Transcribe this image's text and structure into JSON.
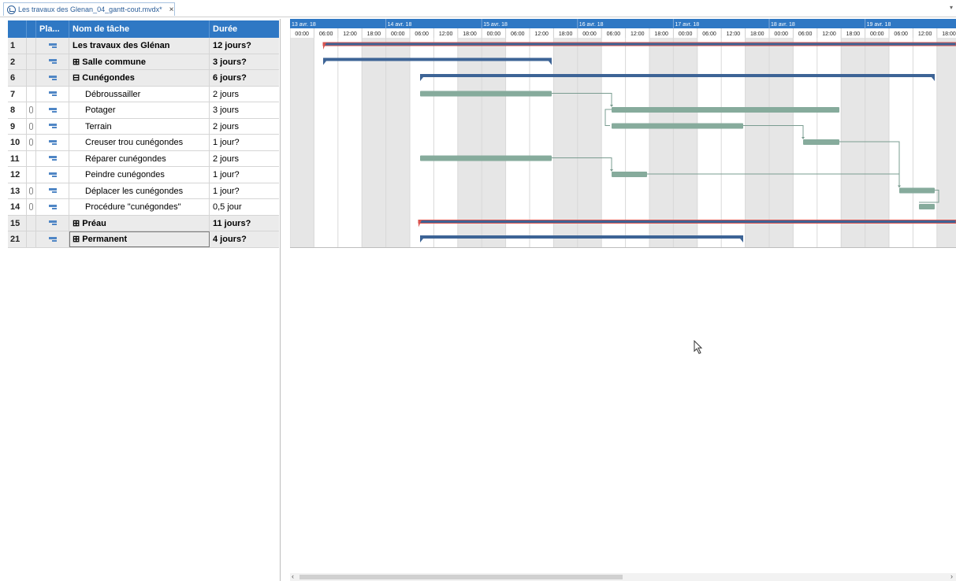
{
  "document_tab": {
    "title": "Les travaux des Glenan_04_gantt-cout.mvdx*",
    "close_label": "×",
    "menu_label": "▾"
  },
  "grid": {
    "columns": [
      "",
      "Pla...",
      "Nom de tâche",
      "Durée"
    ],
    "rows": [
      {
        "id": "1",
        "name": "Les travaux des Glénan",
        "duration": "12 jours?",
        "summary": true,
        "clip": false,
        "indent": 0,
        "prefix": ""
      },
      {
        "id": "2",
        "name": "Salle commune",
        "duration": "3 jours?",
        "summary": true,
        "clip": false,
        "indent": 0,
        "prefix": "⊞ "
      },
      {
        "id": "6",
        "name": "Cunégondes",
        "duration": "6 jours?",
        "summary": true,
        "clip": false,
        "indent": 0,
        "prefix": "⊟ "
      },
      {
        "id": "7",
        "name": "Débroussailler",
        "duration": "2 jours",
        "summary": false,
        "clip": false,
        "indent": 1,
        "prefix": ""
      },
      {
        "id": "8",
        "name": "Potager",
        "duration": "3 jours",
        "summary": false,
        "clip": true,
        "indent": 1,
        "prefix": ""
      },
      {
        "id": "9",
        "name": "Terrain",
        "duration": "2 jours",
        "summary": false,
        "clip": true,
        "indent": 1,
        "prefix": ""
      },
      {
        "id": "10",
        "name": "Creuser trou cunégondes",
        "duration": "1 jour?",
        "summary": false,
        "clip": true,
        "indent": 1,
        "prefix": ""
      },
      {
        "id": "11",
        "name": "Réparer cunégondes",
        "duration": "2 jours",
        "summary": false,
        "clip": false,
        "indent": 1,
        "prefix": ""
      },
      {
        "id": "12",
        "name": "Peindre cunégondes",
        "duration": "1 jour?",
        "summary": false,
        "clip": false,
        "indent": 1,
        "prefix": ""
      },
      {
        "id": "13",
        "name": "Déplacer les cunégondes",
        "duration": "1 jour?",
        "summary": false,
        "clip": true,
        "indent": 1,
        "prefix": ""
      },
      {
        "id": "14",
        "name": "Procédure \"cunégondes\"",
        "duration": "0,5 jour",
        "summary": false,
        "clip": true,
        "indent": 1,
        "prefix": ""
      },
      {
        "id": "15",
        "name": "Préau",
        "duration": "11 jours?",
        "summary": true,
        "clip": false,
        "indent": 0,
        "prefix": "⊞ "
      },
      {
        "id": "21",
        "name": "Permanent",
        "duration": "4 jours?",
        "summary": true,
        "clip": false,
        "indent": 0,
        "prefix": "⊞ "
      }
    ]
  },
  "timescale": {
    "days": [
      "13 avr. 18",
      "14 avr. 18",
      "15 avr. 18",
      "16 avr. 18",
      "17 avr. 18",
      "18 avr. 18",
      "19 avr. 18"
    ],
    "hours": [
      "00:00",
      "06:00",
      "12:00",
      "18:00"
    ]
  },
  "colors": {
    "header_blue": "#2f78c4",
    "summary_bar": "#3d6496",
    "task_bar": "#86ab9c",
    "project_bar_red": "#d9534f",
    "weekend_shade": "#e6e6e6"
  }
}
